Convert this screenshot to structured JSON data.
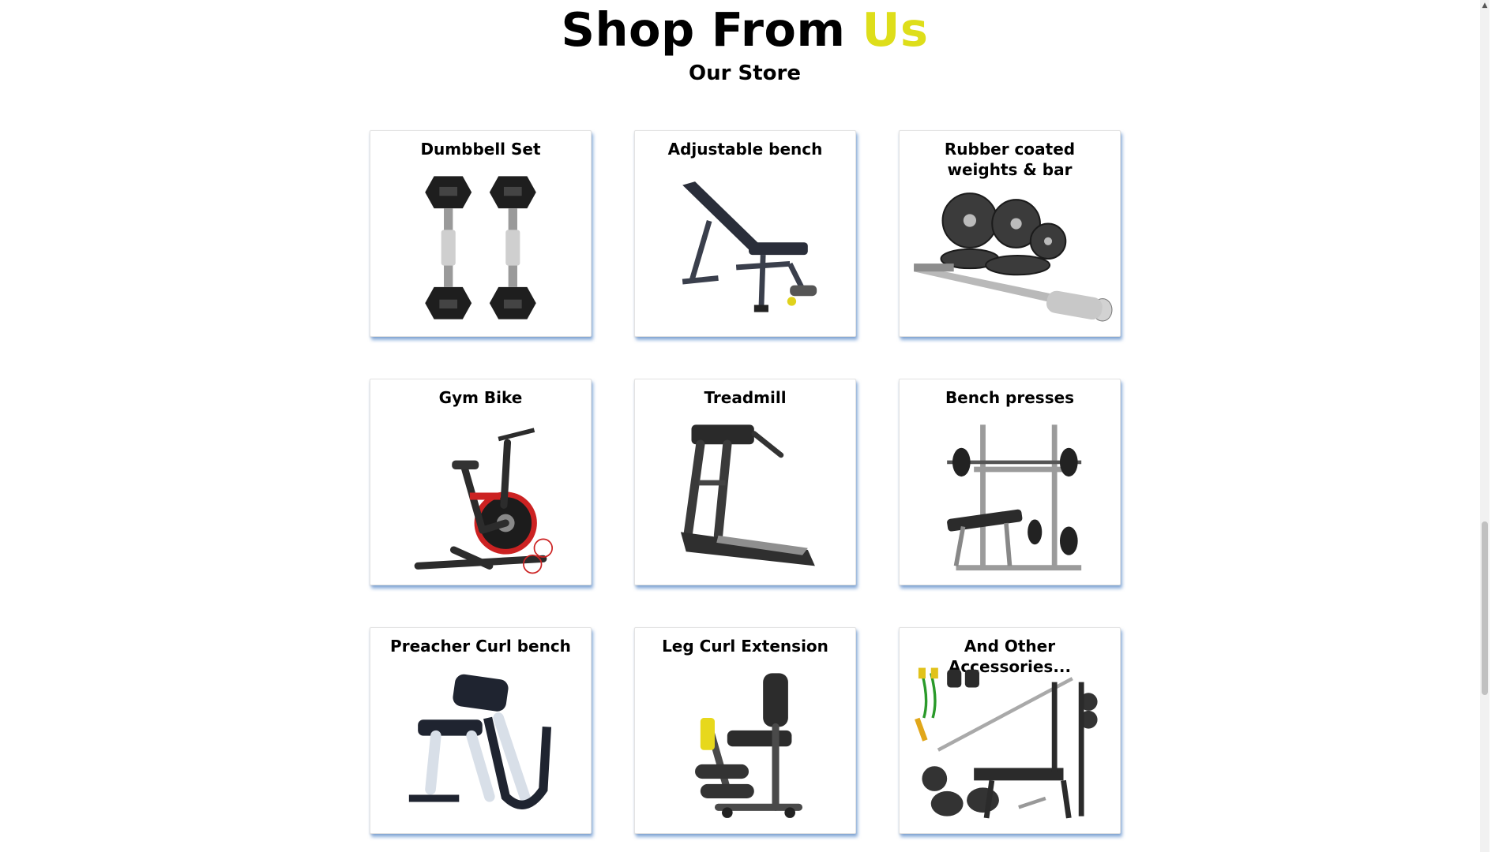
{
  "header": {
    "title_main": "Shop From",
    "title_accent": "Us",
    "subtitle": "Our Store"
  },
  "products": [
    {
      "name": "Dumbbell Set",
      "icon": "dumbbell-set-icon"
    },
    {
      "name": "Adjustable bench",
      "icon": "adjustable-bench-icon"
    },
    {
      "name": "Rubber coated weights & bar",
      "icon": "weights-and-bar-icon"
    },
    {
      "name": "Gym Bike",
      "icon": "gym-bike-icon"
    },
    {
      "name": "Treadmill",
      "icon": "treadmill-icon"
    },
    {
      "name": "Bench presses",
      "icon": "bench-press-icon"
    },
    {
      "name": "Preacher Curl bench",
      "icon": "preacher-curl-bench-icon"
    },
    {
      "name": "Leg Curl Extension",
      "icon": "leg-curl-extension-icon"
    },
    {
      "name": "And Other Accessories...",
      "icon": "accessories-icon"
    }
  ],
  "colors": {
    "accent": "#dede1a",
    "card_shadow": "#2b6cbe",
    "scrollbar_thumb": "#c1c1c1"
  }
}
